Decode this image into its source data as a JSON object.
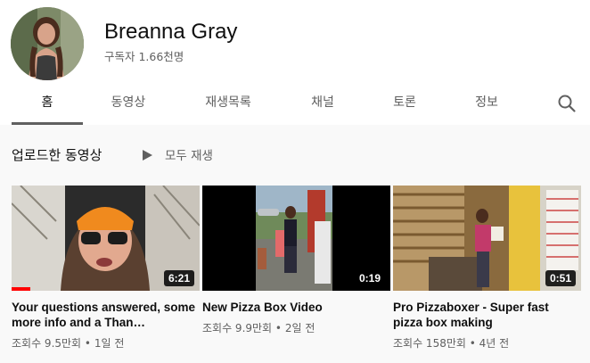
{
  "channel": {
    "name": "Breanna Gray",
    "subscribers": "구독자 1.66천명"
  },
  "tabs": [
    {
      "label": "홈",
      "active": true
    },
    {
      "label": "동영상"
    },
    {
      "label": "재생목록"
    },
    {
      "label": "채널"
    },
    {
      "label": "토론"
    },
    {
      "label": "정보"
    }
  ],
  "section": {
    "title": "업로드한 동영상",
    "play_all": "모두 재생"
  },
  "videos": [
    {
      "title": "Your questions answered, some more info and a Than…",
      "duration": "6:21",
      "views": "조회수 9.5만회",
      "age": "1일 전",
      "watched_fraction": 0.1
    },
    {
      "title": "New Pizza Box Video",
      "duration": "0:19",
      "views": "조회수 9.9만회",
      "age": "2일 전"
    },
    {
      "title": "Pro Pizzaboxer - Super fast pizza box making",
      "duration": "0:51",
      "views": "조회수 158만회",
      "age": "4년 전"
    }
  ],
  "icons": {
    "search": "search-icon",
    "play": "play-icon"
  },
  "colors": {
    "progress": "#ff0000",
    "tab_active_underline": "#606060"
  }
}
